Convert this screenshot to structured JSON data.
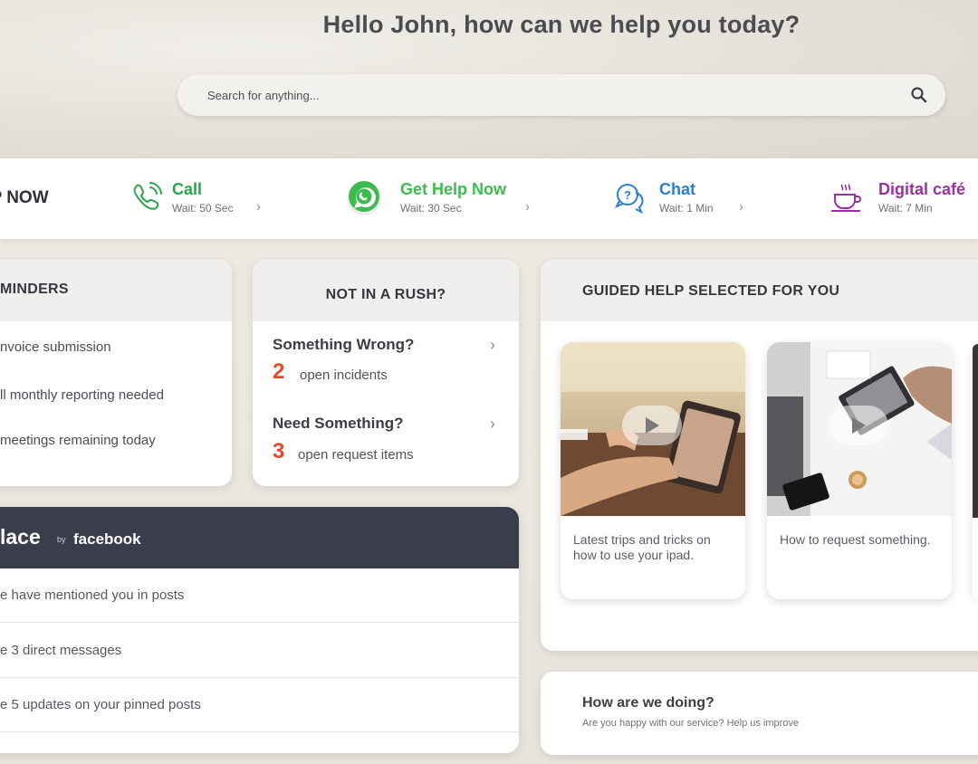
{
  "header": {
    "greeting": "Hello John, how can we help you today?",
    "search_placeholder": "Search for anything..."
  },
  "help_now": {
    "title": "LP NOW",
    "channels": [
      {
        "name": "Call",
        "wait": "Wait: 50 Sec",
        "color": "#2aa64a",
        "icon": "phone-icon"
      },
      {
        "name": "Get Help Now",
        "wait": "Wait: 30 Sec",
        "color": "#3dbb4e",
        "icon": "whatsapp-icon"
      },
      {
        "name": "Chat",
        "wait": "Wait: 1 Min",
        "color": "#2a7fd0",
        "icon": "chat-bubbles-icon"
      },
      {
        "name": "Digital café",
        "wait": "Wait: 7 Min",
        "color": "#9b2fa3",
        "icon": "coffee-cup-icon"
      }
    ]
  },
  "reminders": {
    "title": "MINDERS",
    "items": [
      "nvoice submission",
      "ll monthly reporting needed",
      "meetings remaining today"
    ]
  },
  "rush": {
    "title": "NOT IN A RUSH?",
    "items": [
      {
        "title": "Something Wrong?",
        "count": "2",
        "label": "open incidents"
      },
      {
        "title": "Need Something?",
        "count": "3",
        "label": "open request items"
      }
    ]
  },
  "workplace": {
    "title": "lace",
    "by": "by",
    "brand": "facebook",
    "rows": [
      "e have mentioned you in posts",
      "e 3 direct messages",
      "e 5 updates on your pinned posts"
    ]
  },
  "guided": {
    "title": "GUIDED HELP SELECTED FOR YOU",
    "videos": [
      {
        "caption": "Latest trips and tricks on how to use your ipad."
      },
      {
        "caption": "How to request something."
      }
    ]
  },
  "feedback": {
    "title": "How are we doing?",
    "subtitle": "Are you happy with our service? Help us improve"
  }
}
